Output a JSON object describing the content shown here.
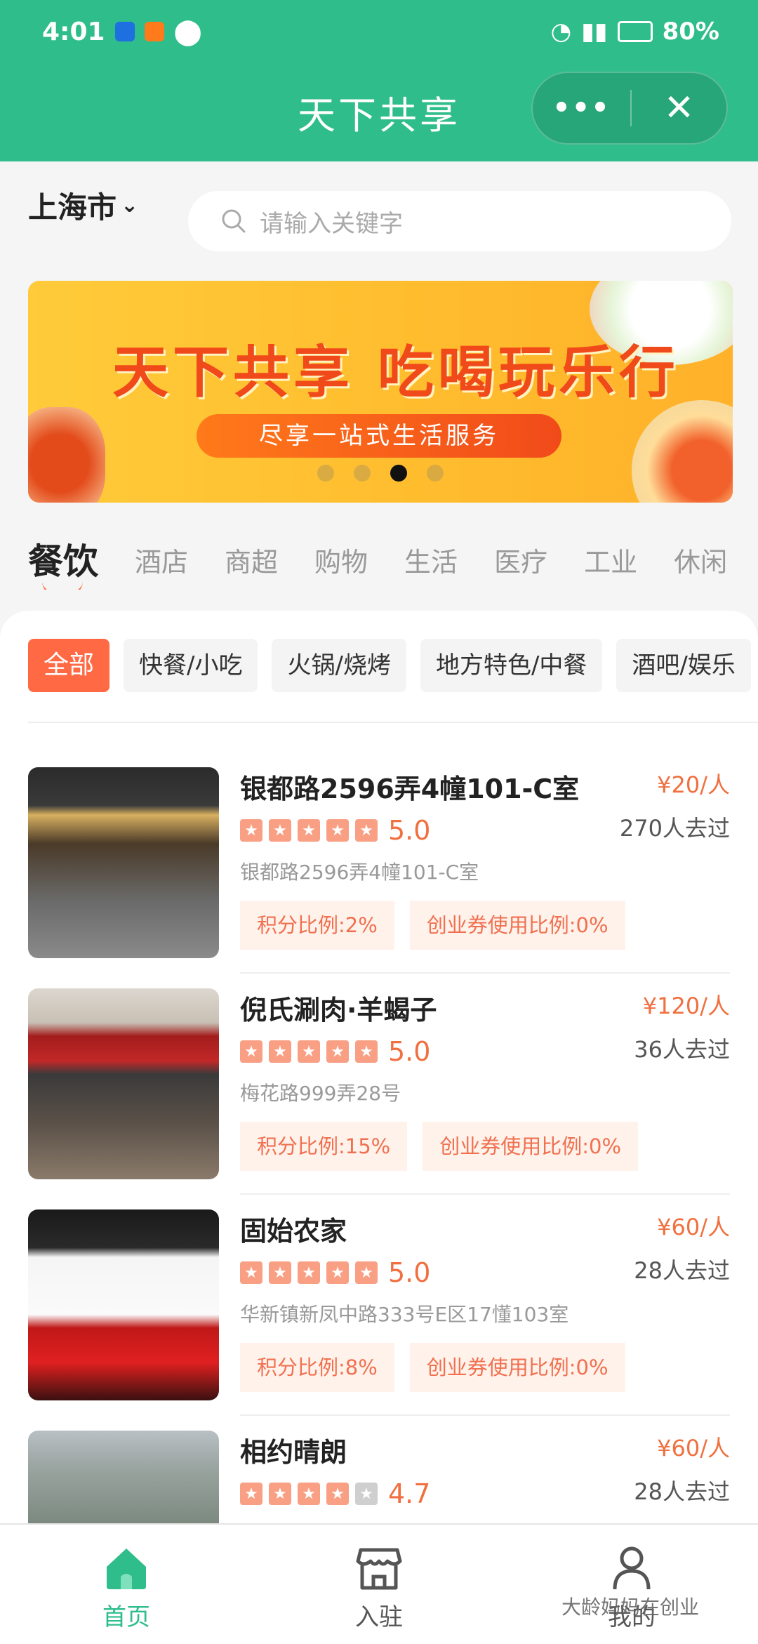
{
  "status": {
    "time": "4:01",
    "battery": "80%"
  },
  "header": {
    "title": "天下共享"
  },
  "capsule": {
    "more": "•••",
    "close": "✕"
  },
  "location": {
    "city": "上海市",
    "chevron": "⌄"
  },
  "search": {
    "placeholder": "请输入关键字"
  },
  "banner": {
    "headline": "天下共享  吃喝玩乐行",
    "subtitle": "尽享一站式生活服务",
    "active_dot": 3,
    "dot_count": 4
  },
  "categories": [
    "餐饮",
    "酒店",
    "商超",
    "购物",
    "生活",
    "医疗",
    "工业",
    "休闲"
  ],
  "subcategories": [
    "全部",
    "快餐/小吃",
    "火锅/烧烤",
    "地方特色/中餐",
    "酒吧/娱乐"
  ],
  "listings": [
    {
      "name": "银都路2596弄4幢101-C室",
      "price": "¥20/人",
      "rating": "5.0",
      "stars": 5,
      "visits": "270人去过",
      "address": "银都路2596弄4幢101-C室",
      "points": "积分比例:2%",
      "coupon": "创业券使用比例:0%"
    },
    {
      "name": "倪氏涮肉·羊蝎子",
      "price": "¥120/人",
      "rating": "5.0",
      "stars": 5,
      "visits": "36人去过",
      "address": "梅花路999弄28号",
      "points": "积分比例:15%",
      "coupon": "创业券使用比例:0%"
    },
    {
      "name": "固始农家",
      "price": "¥60/人",
      "rating": "5.0",
      "stars": 5,
      "visits": "28人去过",
      "address": "华新镇新凤中路333号E区17懂103室",
      "points": "积分比例:8%",
      "coupon": "创业券使用比例:0%"
    },
    {
      "name": "相约晴朗",
      "price": "¥60/人",
      "rating": "4.7",
      "stars": 4,
      "visits": "28人去过",
      "address": "",
      "points": "",
      "coupon": ""
    }
  ],
  "tabbar": [
    {
      "label": "首页",
      "icon": "home-icon",
      "active": true
    },
    {
      "label": "入驻",
      "icon": "store-icon",
      "active": false
    },
    {
      "label": "我的",
      "icon": "user-icon",
      "active": false
    }
  ],
  "watermark": "大龄妈妈在创业",
  "colors": {
    "brand_green": "#2ebd8b",
    "accent_orange": "#f07040",
    "active_chip": "#ff6a45"
  }
}
